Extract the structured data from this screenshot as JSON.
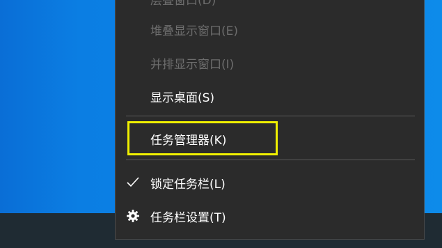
{
  "menu": {
    "items": [
      {
        "label": "层叠窗口(D)",
        "state": "disabled"
      },
      {
        "label": "堆叠显示窗口(E)",
        "state": "disabled"
      },
      {
        "label": "并排显示窗口(I)",
        "state": "disabled"
      },
      {
        "label": "显示桌面(S)",
        "state": "enabled"
      },
      {
        "label": "任务管理器(K)",
        "state": "enabled",
        "highlighted": true
      },
      {
        "label": "锁定任务栏(L)",
        "state": "enabled",
        "checked": true,
        "icon": "checkmark-icon"
      },
      {
        "label": "任务栏设置(T)",
        "state": "enabled",
        "icon": "gear-icon"
      }
    ]
  },
  "colors": {
    "menu_background": "#2b2b2b",
    "text_enabled": "#ffffff",
    "text_disabled": "#6d6d6d",
    "highlight_border": "#f0f000",
    "desktop_blue": "#0b7ee3",
    "taskbar": "#1f2b33"
  }
}
